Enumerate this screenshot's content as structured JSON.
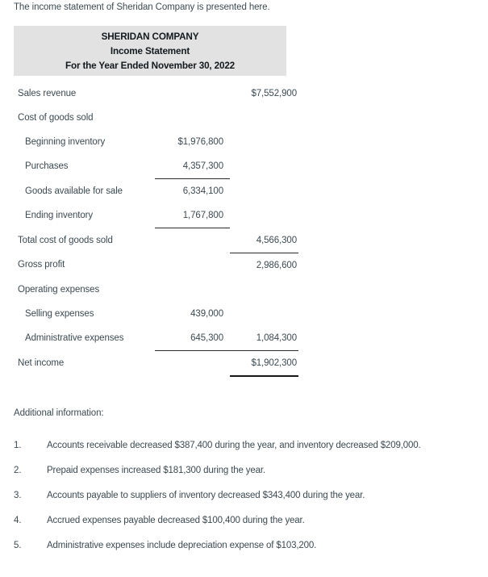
{
  "intro": "The income statement of Sheridan Company is presented here.",
  "statement": {
    "header": {
      "company": "SHERIDAN COMPANY",
      "title": "Income Statement",
      "period": "For the Year Ended November 30, 2022"
    },
    "rows": [
      {
        "label": "Sales revenue",
        "indent": false,
        "col1": "",
        "col2": "$7,552,900",
        "rule1": "",
        "rule2": ""
      },
      {
        "label": "Cost of goods sold",
        "indent": false,
        "col1": "",
        "col2": "",
        "rule1": "",
        "rule2": ""
      },
      {
        "label": "Beginning inventory",
        "indent": true,
        "col1": "$1,976,800",
        "col2": "",
        "rule1": "",
        "rule2": ""
      },
      {
        "label": "Purchases",
        "indent": true,
        "col1": "4,357,300",
        "col2": "",
        "rule1": "single",
        "rule2": ""
      },
      {
        "label": "Goods available for sale",
        "indent": true,
        "col1": "6,334,100",
        "col2": "",
        "rule1": "",
        "rule2": ""
      },
      {
        "label": "Ending inventory",
        "indent": true,
        "col1": "1,767,800",
        "col2": "",
        "rule1": "single",
        "rule2": ""
      },
      {
        "label": "Total cost of goods sold",
        "indent": false,
        "col1": "",
        "col2": "4,566,300",
        "rule1": "",
        "rule2": "single"
      },
      {
        "label": "Gross profit",
        "indent": false,
        "col1": "",
        "col2": "2,986,600",
        "rule1": "",
        "rule2": ""
      },
      {
        "label": "Operating expenses",
        "indent": false,
        "col1": "",
        "col2": "",
        "rule1": "",
        "rule2": ""
      },
      {
        "label": "Selling expenses",
        "indent": true,
        "col1": "439,000",
        "col2": "",
        "rule1": "",
        "rule2": ""
      },
      {
        "label": "Administrative expenses",
        "indent": true,
        "col1": "645,300",
        "col2": "1,084,300",
        "rule1": "single",
        "rule2": "single"
      },
      {
        "label": "Net income",
        "indent": false,
        "col1": "",
        "col2": "$1,902,300",
        "rule1": "",
        "rule2": "double"
      }
    ]
  },
  "additional": {
    "title": "Additional information:",
    "items": [
      {
        "num": "1.",
        "text": "Accounts receivable decreased $387,400 during the year, and inventory decreased $209,000."
      },
      {
        "num": "2.",
        "text": "Prepaid expenses increased $181,300 during the year."
      },
      {
        "num": "3.",
        "text": "Accounts payable to suppliers of inventory decreased $343,400 during the year."
      },
      {
        "num": "4.",
        "text": "Accrued expenses payable decreased $100,400 during the year."
      },
      {
        "num": "5.",
        "text": "Administrative expenses include depreciation expense of $103,200."
      }
    ]
  },
  "colors": {
    "header_background": "#e2e2e2",
    "text": "#3c4a52",
    "rule": "#2a2a2a"
  }
}
